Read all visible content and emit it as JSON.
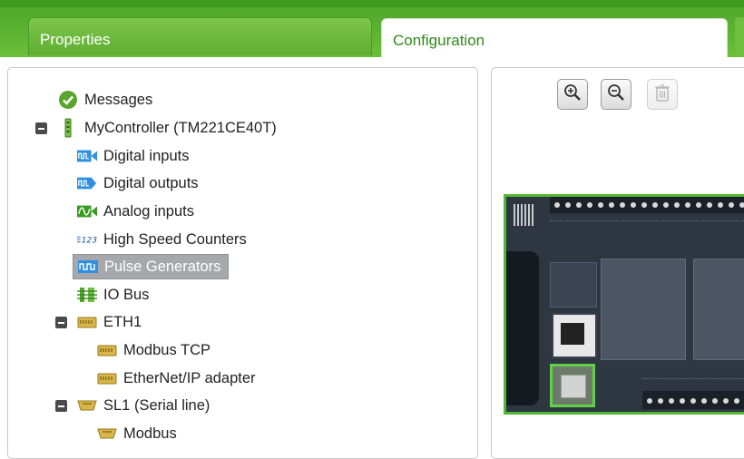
{
  "tabs": [
    {
      "label": "Properties",
      "active": false
    },
    {
      "label": "Configuration",
      "active": true
    }
  ],
  "tree": [
    {
      "label": "Messages",
      "icon": "check-icon"
    },
    {
      "label": "MyController (TM221CE40T)",
      "icon": "controller-icon"
    },
    {
      "label": "Digital inputs",
      "icon": "digital-inputs-icon"
    },
    {
      "label": "Digital outputs",
      "icon": "digital-outputs-icon"
    },
    {
      "label": "Analog inputs",
      "icon": "analog-inputs-icon"
    },
    {
      "label": "High Speed Counters",
      "icon": "counter-icon"
    },
    {
      "label": "Pulse Generators",
      "icon": "pulse-icon",
      "selected": true
    },
    {
      "label": "IO Bus",
      "icon": "io-bus-icon"
    },
    {
      "label": "ETH1",
      "icon": "ethernet-port-icon"
    },
    {
      "label": "Modbus TCP",
      "icon": "ethernet-port-icon"
    },
    {
      "label": "EtherNet/IP adapter",
      "icon": "ethernet-port-icon"
    },
    {
      "label": "SL1 (Serial line)",
      "icon": "serial-port-icon"
    },
    {
      "label": "Modbus",
      "icon": "serial-port-icon"
    }
  ],
  "toolbar": {
    "zoom_in": "zoom-in-icon",
    "zoom_out": "zoom-out-icon",
    "delete": "trash-icon"
  },
  "colors": {
    "accent": "#5bb030",
    "selected_bg": "#a6a8ab",
    "device_border": "#51b833"
  }
}
